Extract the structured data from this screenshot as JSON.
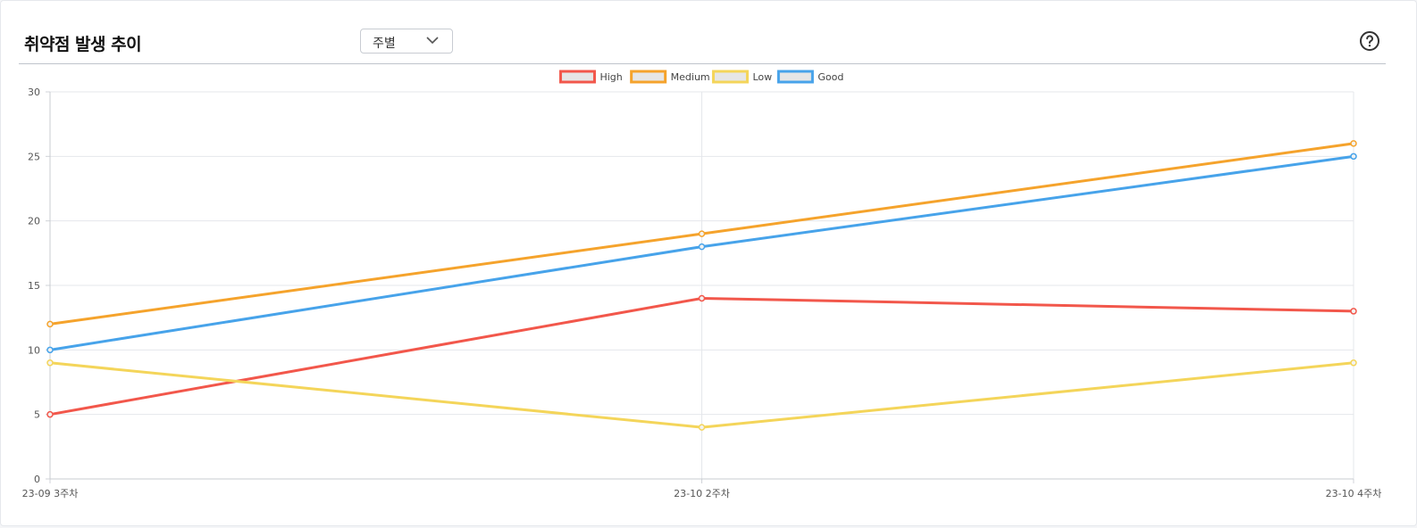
{
  "widget": {
    "title": "취약점 발생 추이",
    "period_select": {
      "value": "주별"
    },
    "help_icon": "question-circle-icon"
  },
  "chart_data": {
    "type": "line",
    "categories": [
      "23-09 3주차",
      "23-10 2주차",
      "23-10 4주차"
    ],
    "series": [
      {
        "name": "High",
        "color": "#f2574b",
        "values": [
          5,
          14,
          13
        ]
      },
      {
        "name": "Medium",
        "color": "#f5a32c",
        "values": [
          12,
          19,
          26
        ]
      },
      {
        "name": "Low",
        "color": "#f4d55a",
        "values": [
          9,
          4,
          9
        ]
      },
      {
        "name": "Good",
        "color": "#47a3ea",
        "values": [
          10,
          18,
          25
        ]
      }
    ],
    "ylim": [
      0,
      30
    ],
    "yticks": [
      0,
      5,
      10,
      15,
      20,
      25,
      30
    ],
    "grid": true,
    "legend_position": "top"
  }
}
